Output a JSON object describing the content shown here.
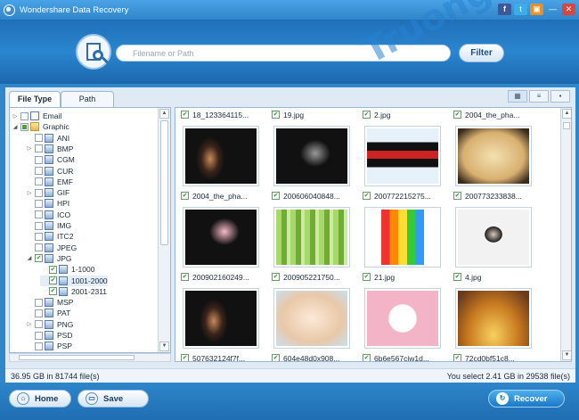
{
  "window": {
    "title": "Wondershare Data Recovery",
    "buttons": {
      "facebook": "f",
      "twitter": "t",
      "rss": "▣",
      "minimize": "—",
      "close": "✕"
    }
  },
  "search": {
    "placeholder": "Filename or Path",
    "value": "",
    "filter_label": "Filter"
  },
  "tabs": [
    {
      "label": "File Type",
      "active": true
    },
    {
      "label": "Path",
      "active": false
    }
  ],
  "tree": {
    "items": [
      {
        "label": "Email",
        "depth": 0,
        "expander": "▷",
        "check": "none",
        "icon": "mail-icon"
      },
      {
        "label": "Graphic",
        "depth": 0,
        "expander": "◢",
        "check": "partial",
        "icon": "folder-icon"
      },
      {
        "label": "ANI",
        "depth": 1,
        "expander": "",
        "check": "none",
        "icon": "image-file-icon"
      },
      {
        "label": "BMP",
        "depth": 1,
        "expander": "▷",
        "check": "none",
        "icon": "image-file-icon"
      },
      {
        "label": "CGM",
        "depth": 1,
        "expander": "",
        "check": "none",
        "icon": "image-file-icon"
      },
      {
        "label": "CUR",
        "depth": 1,
        "expander": "",
        "check": "none",
        "icon": "image-file-icon"
      },
      {
        "label": "EMF",
        "depth": 1,
        "expander": "",
        "check": "none",
        "icon": "image-file-icon"
      },
      {
        "label": "GIF",
        "depth": 1,
        "expander": "▷",
        "check": "none",
        "icon": "image-file-icon"
      },
      {
        "label": "HPI",
        "depth": 1,
        "expander": "",
        "check": "none",
        "icon": "image-file-icon"
      },
      {
        "label": "ICO",
        "depth": 1,
        "expander": "",
        "check": "none",
        "icon": "image-file-icon"
      },
      {
        "label": "IMG",
        "depth": 1,
        "expander": "",
        "check": "none",
        "icon": "image-file-icon"
      },
      {
        "label": "ITC2",
        "depth": 1,
        "expander": "",
        "check": "none",
        "icon": "image-file-icon"
      },
      {
        "label": "JPEG",
        "depth": 1,
        "expander": "",
        "check": "none",
        "icon": "image-file-icon"
      },
      {
        "label": "JPG",
        "depth": 1,
        "expander": "◢",
        "check": "checked",
        "icon": "image-file-icon"
      },
      {
        "label": "1-1000",
        "depth": 2,
        "expander": "",
        "check": "checked",
        "icon": "image-file-icon"
      },
      {
        "label": "1001-2000",
        "depth": 2,
        "expander": "",
        "check": "checked",
        "icon": "image-file-icon",
        "selected": true
      },
      {
        "label": "2001-2311",
        "depth": 2,
        "expander": "",
        "check": "checked",
        "icon": "image-file-icon"
      },
      {
        "label": "MSP",
        "depth": 1,
        "expander": "",
        "check": "none",
        "icon": "image-file-icon"
      },
      {
        "label": "PAT",
        "depth": 1,
        "expander": "",
        "check": "none",
        "icon": "image-file-icon"
      },
      {
        "label": "PNG",
        "depth": 1,
        "expander": "▷",
        "check": "none",
        "icon": "image-file-icon"
      },
      {
        "label": "PSD",
        "depth": 1,
        "expander": "",
        "check": "none",
        "icon": "image-file-icon"
      },
      {
        "label": "PSP",
        "depth": 1,
        "expander": "",
        "check": "none",
        "icon": "image-file-icon"
      }
    ]
  },
  "view_modes": [
    {
      "icon": "thumbnail-view-icon",
      "glyph": "▦",
      "active": true
    },
    {
      "icon": "list-view-icon",
      "glyph": "≡",
      "active": false
    },
    {
      "icon": "detail-view-icon",
      "glyph": "▪",
      "active": false
    }
  ],
  "grid": {
    "top_captions": [
      "18_123364115...",
      "19.jpg",
      "2.jpg",
      "2004_the_pha..."
    ],
    "rows": [
      [
        "2004_the_pha...",
        "200606040848...",
        "200772215275...",
        "200773233838..."
      ],
      [
        "200902160249...",
        "200905221750...",
        "21.jpg",
        "4.jpg"
      ],
      [
        "507632124f7f...",
        "604e48d0x908...",
        "6b6e567cjw1d...",
        "72cd0bf51c8..."
      ]
    ]
  },
  "watermark": "Truongthe.com",
  "status": {
    "left": "36.95 GB in 81744 file(s)",
    "right": "You select 2.41 GB in 29538 file(s)"
  },
  "footer": {
    "home_label": "Home",
    "save_label": "Save",
    "recover_label": "Recover"
  },
  "colors": {
    "accent": "#2f86c9",
    "close": "#d9473c",
    "check": "#2a9a2a"
  }
}
